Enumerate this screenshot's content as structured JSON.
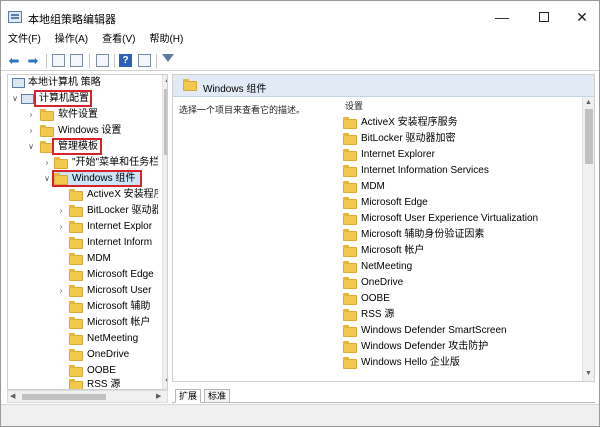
{
  "window": {
    "title": "本地组策略编辑器",
    "minimize": "—",
    "close": "✕"
  },
  "menu": [
    "文件(F)",
    "操作(A)",
    "查看(V)",
    "帮助(H)"
  ],
  "toolbar": {
    "back_icon": "back-arrow-icon",
    "forward_icon": "forward-arrow-icon",
    "help_label": "?"
  },
  "tree": {
    "root": "本地计算机 策略",
    "computer_config": "计算机配置",
    "software_settings": "软件设置",
    "windows_settings": "Windows 设置",
    "admin_templates": "管理模板",
    "start_menu": "\"开始\"菜单和任务栏",
    "windows_components": "Windows 组件",
    "children": [
      "ActiveX 安装程序",
      "BitLocker 驱动器",
      "Internet Explor",
      "Internet Inform",
      "MDM",
      "Microsoft Edge",
      "Microsoft User",
      "Microsoft 辅助",
      "Microsoft 帐户",
      "NetMeeting",
      "OneDrive",
      "OOBE",
      "RSS 源"
    ]
  },
  "right": {
    "header": "Windows 组件",
    "description": "选择一个项目来查看它的描述。",
    "column_header": "设置",
    "items": [
      "ActiveX 安装程序服务",
      "BitLocker 驱动器加密",
      "Internet Explorer",
      "Internet Information Services",
      "MDM",
      "Microsoft Edge",
      "Microsoft User Experience Virtualization",
      "Microsoft 辅助身份验证因素",
      "Microsoft 帐户",
      "NetMeeting",
      "OneDrive",
      "OOBE",
      "RSS 源",
      "Windows Defender SmartScreen",
      "Windows Defender 攻击防护",
      "Windows Hello 企业版"
    ]
  },
  "tabs": [
    "扩展",
    "标准"
  ],
  "colors": {
    "highlight_border": "#d8232a",
    "folder": "#f2c94c",
    "header_bar": "#e2eaf5"
  }
}
